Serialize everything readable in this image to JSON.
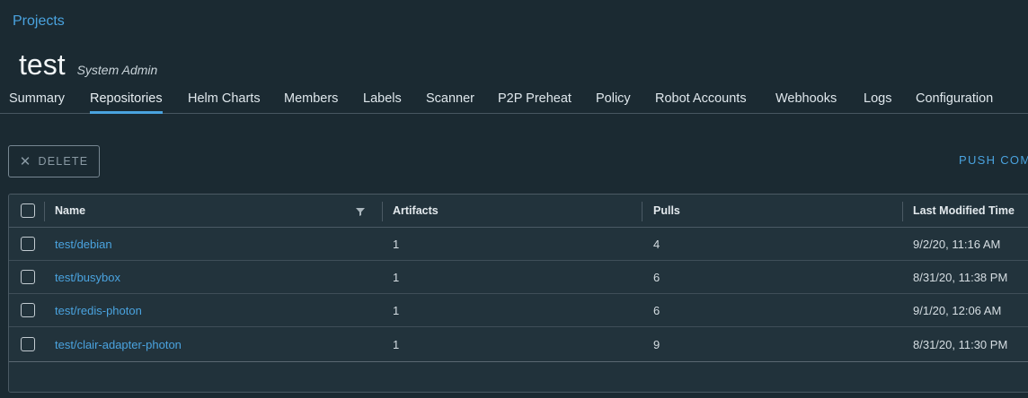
{
  "breadcrumb": "Projects",
  "project": {
    "name": "test",
    "role": "System Admin"
  },
  "tabs": [
    {
      "label": "Summary"
    },
    {
      "label": "Repositories",
      "active": true
    },
    {
      "label": "Helm Charts"
    },
    {
      "label": "Members"
    },
    {
      "label": "Labels"
    },
    {
      "label": "Scanner"
    },
    {
      "label": "P2P Preheat"
    },
    {
      "label": "Policy"
    },
    {
      "label": "Robot Accounts"
    },
    {
      "label": "Webhooks"
    },
    {
      "label": "Logs"
    },
    {
      "label": "Configuration"
    }
  ],
  "toolbar": {
    "delete_label": "DELETE",
    "push_command_label": "PUSH COM"
  },
  "table": {
    "columns": [
      "Name",
      "Artifacts",
      "Pulls",
      "Last Modified Time"
    ],
    "rows": [
      {
        "name": "test/debian",
        "artifacts": "1",
        "pulls": "4",
        "modified": "9/2/20, 11:16 AM"
      },
      {
        "name": "test/busybox",
        "artifacts": "1",
        "pulls": "6",
        "modified": "8/31/20, 11:38 PM"
      },
      {
        "name": "test/redis-photon",
        "artifacts": "1",
        "pulls": "6",
        "modified": "9/1/20, 12:06 AM"
      },
      {
        "name": "test/clair-adapter-photon",
        "artifacts": "1",
        "pulls": "9",
        "modified": "8/31/20, 11:30 PM"
      }
    ]
  },
  "colors": {
    "accent": "#4aa3df",
    "background": "#1b2a32"
  }
}
